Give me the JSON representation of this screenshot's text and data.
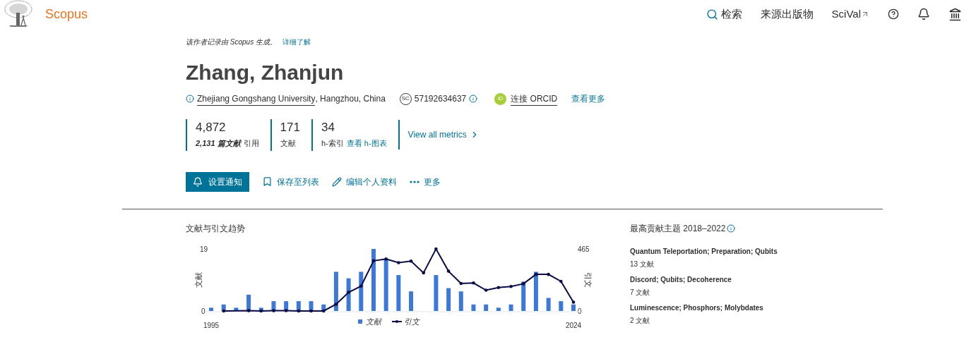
{
  "header": {
    "brand": "Scopus",
    "nav": [
      {
        "kind": "search",
        "label": "检索"
      },
      {
        "kind": "plain",
        "label": "来源出版物"
      },
      {
        "kind": "external",
        "label": "SciVal"
      },
      {
        "kind": "help"
      },
      {
        "kind": "bell"
      },
      {
        "kind": "institution"
      }
    ]
  },
  "notice": {
    "text": "该作者记录由 Scopus 生成。",
    "link": "详细了解"
  },
  "author": {
    "name": "Zhang, Zhanjun",
    "affiliation": "Zhejiang Gongshang University",
    "location": ", Hangzhou, China",
    "id_badge": "SC",
    "scopus_id": "57192634637",
    "orcid_badge": "iD",
    "orcid_link": "连接 ORCID",
    "more_link": "查看更多"
  },
  "metrics": [
    {
      "kind": "citations",
      "value": "4,872",
      "count": "2,131 篇文献",
      "label": "引用"
    },
    {
      "kind": "documents",
      "value": "171",
      "label": "文献"
    },
    {
      "kind": "hindex",
      "value": "34",
      "label": "h-索引",
      "link": "查看 h-图表"
    }
  ],
  "metrics_link": "View all metrics",
  "actions": [
    {
      "kind": "alert",
      "label": "设置通知"
    },
    {
      "kind": "save",
      "label": "保存至列表"
    },
    {
      "kind": "edit",
      "label": "编辑个人资料"
    },
    {
      "kind": "more",
      "label": "更多"
    }
  ],
  "trend": {
    "title": "文献与引文趋势",
    "chart_data": {
      "type": "bar",
      "x": [
        1995,
        1996,
        1997,
        1998,
        1999,
        2000,
        2001,
        2002,
        2003,
        2004,
        2005,
        2006,
        2007,
        2008,
        2009,
        2010,
        2011,
        2012,
        2013,
        2014,
        2015,
        2016,
        2017,
        2018,
        2019,
        2020,
        2021,
        2022,
        2023,
        2024
      ],
      "xticks": [
        1995,
        2024
      ],
      "xlim": [
        1995,
        2024
      ],
      "legend": "bottom",
      "ylabel": "文献",
      "y2label": "引文",
      "ylim": [
        0,
        19
      ],
      "yticks": [
        0,
        19
      ],
      "y2lim": [
        0,
        465
      ],
      "y2ticks": [
        0,
        465
      ],
      "series": [
        {
          "name": "文献",
          "color": "#3b78d8",
          "values": [
            1,
            2,
            1,
            5,
            1,
            3,
            3,
            3,
            3,
            2,
            12,
            10,
            12,
            19,
            16,
            11,
            6,
            0,
            11,
            7,
            6,
            2,
            2,
            1,
            2,
            9,
            12,
            4,
            3,
            2
          ]
        },
        {
          "name": "引文",
          "color": "#0b0b45",
          "type": "line",
          "axis": "y2",
          "values": [
            null,
            0,
            null,
            2,
            0,
            2,
            3,
            0,
            0,
            0,
            50,
            140,
            186,
            376,
            390,
            362,
            374,
            286,
            465,
            298,
            206,
            210,
            156,
            176,
            184,
            204,
            274,
            274,
            222,
            66
          ]
        }
      ]
    }
  },
  "topics": {
    "title": "最高贡献主题 2018–2022",
    "items": [
      {
        "name": "Quantum Teleportation; Preparation; Qubits",
        "count": "13 文献"
      },
      {
        "name": "Discord; Qubits; Decoherence",
        "count": "7 文献"
      },
      {
        "name": "Luminescence; Phosphors; Molybdates",
        "count": "2 文献"
      }
    ]
  }
}
